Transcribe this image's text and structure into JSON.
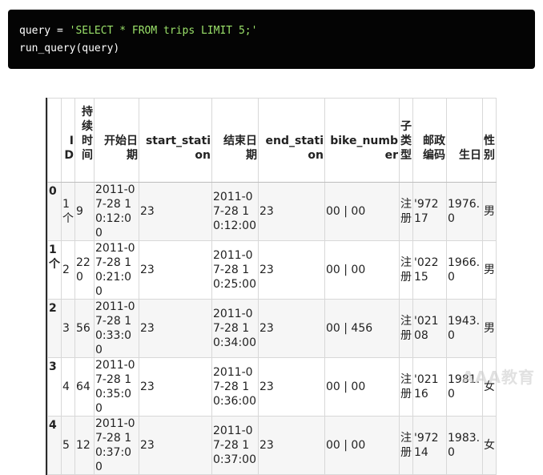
{
  "code": {
    "line1_prefix": "query = ",
    "line1_string": "'SELECT * FROM trips LIMIT 5;'",
    "line2": "run_query(query)"
  },
  "table": {
    "columns": [
      "",
      "ID",
      "持续时间",
      "开始日期",
      "start_station",
      "结束日期",
      "end_station",
      "bike_number",
      "子类型",
      "邮政编码",
      "生日",
      "性别"
    ],
    "rows": [
      [
        "0",
        "1个",
        "9",
        "2011-07-28 10:12:00",
        "23",
        "2011-07-28 10:12:00",
        "23",
        "00 | 00",
        "注册",
        "'97217",
        "1976.0",
        "男"
      ],
      [
        "1个",
        "2",
        "220",
        "2011-07-28 10:21:00",
        "23",
        "2011-07-28 10:25:00",
        "23",
        "00 | 00",
        "注册",
        "'02215",
        "1966.0",
        "男"
      ],
      [
        "2",
        "3",
        "56",
        "2011-07-28 10:33:00",
        "23",
        "2011-07-28 10:34:00",
        "23",
        "00 | 456",
        "注册",
        "'02108",
        "1943.0",
        "男"
      ],
      [
        "3",
        "4",
        "64",
        "2011-07-28 10:35:00",
        "23",
        "2011-07-28 10:36:00",
        "23",
        "00 | 00",
        "注册",
        "'02116",
        "1981.0",
        "女"
      ],
      [
        "4",
        "5",
        "12",
        "2011-07-28 10:37:00",
        "23",
        "2011-07-28 10:37:00",
        "23",
        "00 | 00",
        "注册",
        "'97214",
        "1983.0",
        "女"
      ]
    ]
  },
  "watermark": "AAA教育"
}
